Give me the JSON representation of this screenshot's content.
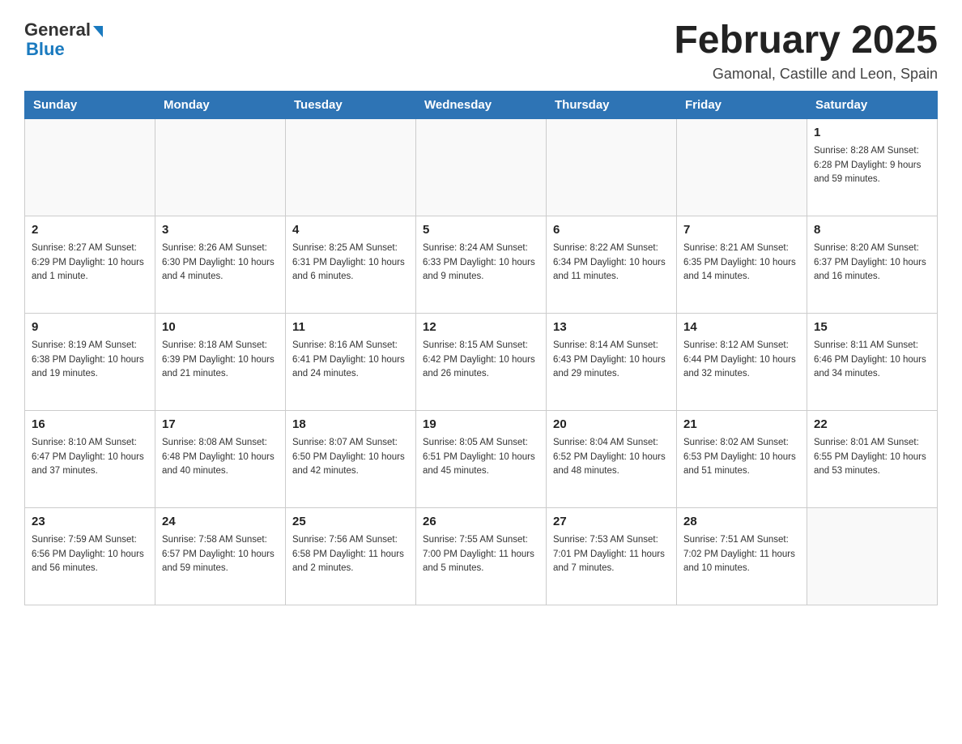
{
  "header": {
    "logo_general": "General",
    "logo_blue": "Blue",
    "month_title": "February 2025",
    "subtitle": "Gamonal, Castille and Leon, Spain"
  },
  "days_of_week": [
    "Sunday",
    "Monday",
    "Tuesday",
    "Wednesday",
    "Thursday",
    "Friday",
    "Saturday"
  ],
  "weeks": [
    [
      {
        "day": "",
        "info": ""
      },
      {
        "day": "",
        "info": ""
      },
      {
        "day": "",
        "info": ""
      },
      {
        "day": "",
        "info": ""
      },
      {
        "day": "",
        "info": ""
      },
      {
        "day": "",
        "info": ""
      },
      {
        "day": "1",
        "info": "Sunrise: 8:28 AM\nSunset: 6:28 PM\nDaylight: 9 hours and 59 minutes."
      }
    ],
    [
      {
        "day": "2",
        "info": "Sunrise: 8:27 AM\nSunset: 6:29 PM\nDaylight: 10 hours and 1 minute."
      },
      {
        "day": "3",
        "info": "Sunrise: 8:26 AM\nSunset: 6:30 PM\nDaylight: 10 hours and 4 minutes."
      },
      {
        "day": "4",
        "info": "Sunrise: 8:25 AM\nSunset: 6:31 PM\nDaylight: 10 hours and 6 minutes."
      },
      {
        "day": "5",
        "info": "Sunrise: 8:24 AM\nSunset: 6:33 PM\nDaylight: 10 hours and 9 minutes."
      },
      {
        "day": "6",
        "info": "Sunrise: 8:22 AM\nSunset: 6:34 PM\nDaylight: 10 hours and 11 minutes."
      },
      {
        "day": "7",
        "info": "Sunrise: 8:21 AM\nSunset: 6:35 PM\nDaylight: 10 hours and 14 minutes."
      },
      {
        "day": "8",
        "info": "Sunrise: 8:20 AM\nSunset: 6:37 PM\nDaylight: 10 hours and 16 minutes."
      }
    ],
    [
      {
        "day": "9",
        "info": "Sunrise: 8:19 AM\nSunset: 6:38 PM\nDaylight: 10 hours and 19 minutes."
      },
      {
        "day": "10",
        "info": "Sunrise: 8:18 AM\nSunset: 6:39 PM\nDaylight: 10 hours and 21 minutes."
      },
      {
        "day": "11",
        "info": "Sunrise: 8:16 AM\nSunset: 6:41 PM\nDaylight: 10 hours and 24 minutes."
      },
      {
        "day": "12",
        "info": "Sunrise: 8:15 AM\nSunset: 6:42 PM\nDaylight: 10 hours and 26 minutes."
      },
      {
        "day": "13",
        "info": "Sunrise: 8:14 AM\nSunset: 6:43 PM\nDaylight: 10 hours and 29 minutes."
      },
      {
        "day": "14",
        "info": "Sunrise: 8:12 AM\nSunset: 6:44 PM\nDaylight: 10 hours and 32 minutes."
      },
      {
        "day": "15",
        "info": "Sunrise: 8:11 AM\nSunset: 6:46 PM\nDaylight: 10 hours and 34 minutes."
      }
    ],
    [
      {
        "day": "16",
        "info": "Sunrise: 8:10 AM\nSunset: 6:47 PM\nDaylight: 10 hours and 37 minutes."
      },
      {
        "day": "17",
        "info": "Sunrise: 8:08 AM\nSunset: 6:48 PM\nDaylight: 10 hours and 40 minutes."
      },
      {
        "day": "18",
        "info": "Sunrise: 8:07 AM\nSunset: 6:50 PM\nDaylight: 10 hours and 42 minutes."
      },
      {
        "day": "19",
        "info": "Sunrise: 8:05 AM\nSunset: 6:51 PM\nDaylight: 10 hours and 45 minutes."
      },
      {
        "day": "20",
        "info": "Sunrise: 8:04 AM\nSunset: 6:52 PM\nDaylight: 10 hours and 48 minutes."
      },
      {
        "day": "21",
        "info": "Sunrise: 8:02 AM\nSunset: 6:53 PM\nDaylight: 10 hours and 51 minutes."
      },
      {
        "day": "22",
        "info": "Sunrise: 8:01 AM\nSunset: 6:55 PM\nDaylight: 10 hours and 53 minutes."
      }
    ],
    [
      {
        "day": "23",
        "info": "Sunrise: 7:59 AM\nSunset: 6:56 PM\nDaylight: 10 hours and 56 minutes."
      },
      {
        "day": "24",
        "info": "Sunrise: 7:58 AM\nSunset: 6:57 PM\nDaylight: 10 hours and 59 minutes."
      },
      {
        "day": "25",
        "info": "Sunrise: 7:56 AM\nSunset: 6:58 PM\nDaylight: 11 hours and 2 minutes."
      },
      {
        "day": "26",
        "info": "Sunrise: 7:55 AM\nSunset: 7:00 PM\nDaylight: 11 hours and 5 minutes."
      },
      {
        "day": "27",
        "info": "Sunrise: 7:53 AM\nSunset: 7:01 PM\nDaylight: 11 hours and 7 minutes."
      },
      {
        "day": "28",
        "info": "Sunrise: 7:51 AM\nSunset: 7:02 PM\nDaylight: 11 hours and 10 minutes."
      },
      {
        "day": "",
        "info": ""
      }
    ]
  ]
}
